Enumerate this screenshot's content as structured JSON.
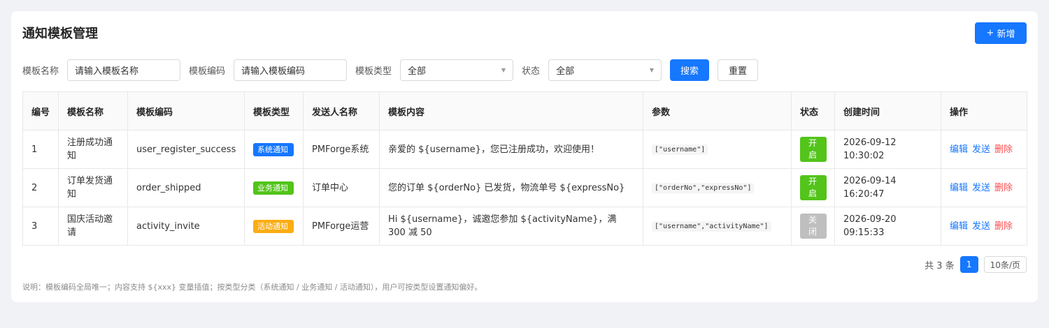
{
  "page": {
    "title": "通知模板管理",
    "add_label": "新增",
    "add_icon": "plus-icon"
  },
  "filters": {
    "name_label": "模板名称",
    "name_placeholder": "请输入模板名称",
    "code_label": "模板编码",
    "code_placeholder": "请输入模板编码",
    "type_label": "模板类型",
    "type_value": "全部",
    "status_label": "状态",
    "status_value": "全部",
    "search_label": "搜索",
    "reset_label": "重置"
  },
  "table": {
    "headers": [
      "编号",
      "模板名称",
      "模板编码",
      "模板类型",
      "发送人名称",
      "模板内容",
      "参数",
      "状态",
      "创建时间",
      "操作"
    ],
    "rows": [
      {
        "id": "1",
        "name": "注册成功通知",
        "code": "user_register_success",
        "type": "系统通知",
        "type_color": "#1677ff",
        "sender": "PMForge系统",
        "content": "亲爱的 ${username}，您已注册成功，欢迎使用！",
        "params": "[\"username\"]",
        "status": "开启",
        "status_color": "#52c41a",
        "created": "2026-09-12 10:30:02"
      },
      {
        "id": "2",
        "name": "订单发货通知",
        "code": "order_shipped",
        "type": "业务通知",
        "type_color": "#52c41a",
        "sender": "订单中心",
        "content": "您的订单 ${orderNo} 已发货，物流单号 ${expressNo}",
        "params": "[\"orderNo\",\"expressNo\"]",
        "status": "开启",
        "status_color": "#52c41a",
        "created": "2026-09-14 16:20:47"
      },
      {
        "id": "3",
        "name": "国庆活动邀请",
        "code": "activity_invite",
        "type": "活动通知",
        "type_color": "#faad14",
        "sender": "PMForge运营",
        "content": "Hi ${username}，诚邀您参加 ${activityName}，满 300 减 50",
        "params": "[\"username\",\"activityName\"]",
        "status": "关闭",
        "status_color": "#bfbfbf",
        "created": "2026-09-20 09:15:33"
      }
    ],
    "actions": {
      "edit": "编辑",
      "send": "发送",
      "delete": "删除"
    }
  },
  "pagination": {
    "total_text": "共 3 条",
    "current_page": "1",
    "page_size": "10条/页"
  },
  "note": "说明：模板编码全局唯一；内容支持 ${xxx} 变量插值；按类型分类（系统通知 / 业务通知 / 活动通知），用户可按类型设置通知偏好。"
}
